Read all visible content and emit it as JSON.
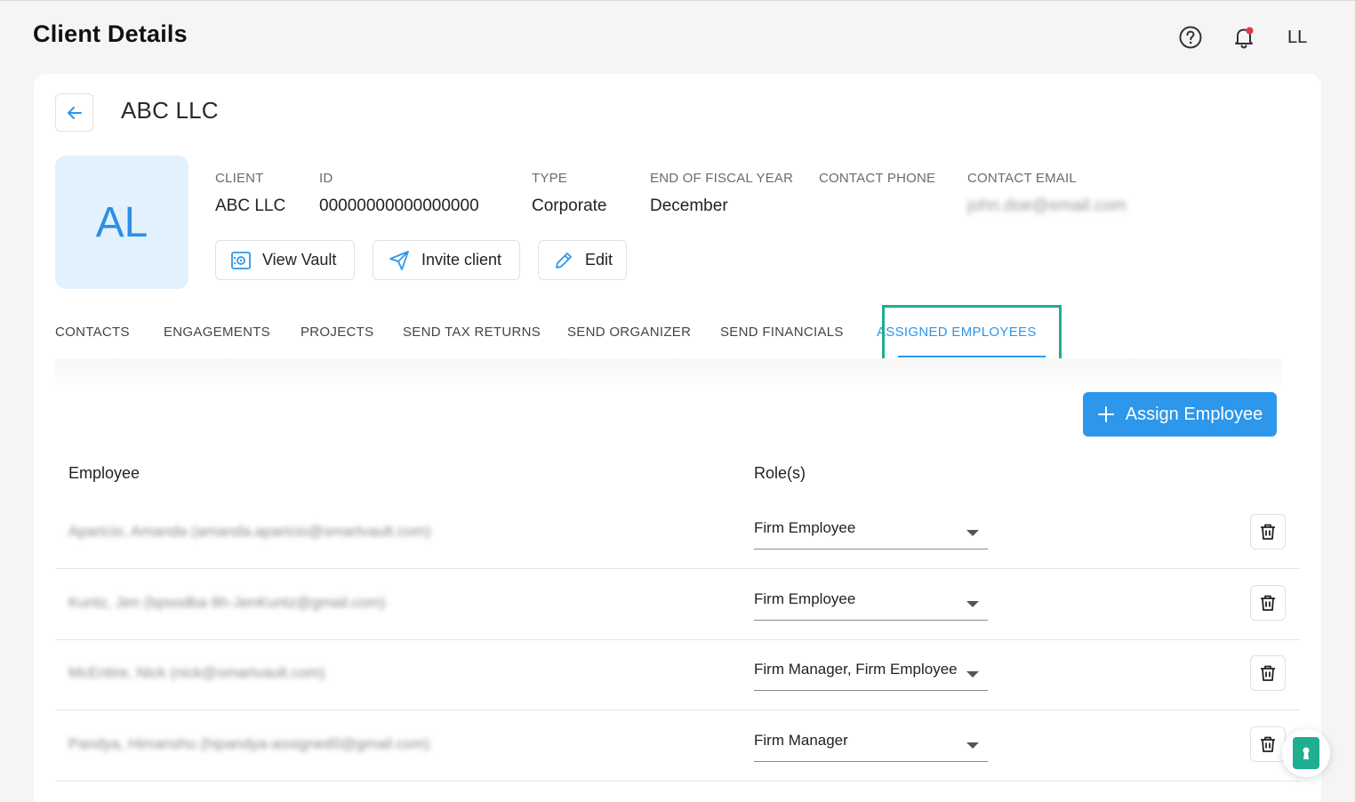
{
  "header": {
    "title": "Client Details",
    "user_initials": "LL"
  },
  "client": {
    "name": "ABC LLC",
    "avatar_initials": "AL",
    "fields": [
      {
        "label": "CLIENT",
        "value": "ABC LLC"
      },
      {
        "label": "ID",
        "value": "00000000000000000"
      },
      {
        "label": "TYPE",
        "value": "Corporate"
      },
      {
        "label": "END OF FISCAL YEAR",
        "value": "December"
      },
      {
        "label": "CONTACT PHONE",
        "value": ""
      },
      {
        "label": "CONTACT EMAIL",
        "value": "john.doe@email.com"
      }
    ]
  },
  "actions": {
    "view_vault": "View Vault",
    "invite_client": "Invite client",
    "edit": "Edit"
  },
  "tabs": [
    {
      "label": "CONTACTS"
    },
    {
      "label": "ENGAGEMENTS"
    },
    {
      "label": "PROJECTS"
    },
    {
      "label": "SEND TAX RETURNS"
    },
    {
      "label": "SEND ORGANIZER"
    },
    {
      "label": "SEND FINANCIALS"
    },
    {
      "label": "ASSIGNED EMPLOYEES"
    }
  ],
  "active_tab": "ASSIGNED EMPLOYEES",
  "assign_button": "Assign Employee",
  "table": {
    "headers": {
      "employee": "Employee",
      "roles": "Role(s)"
    },
    "rows": [
      {
        "employee": "Aparicio, Amanda (amanda.aparicio@smartvault.com)",
        "roles": "Firm Employee"
      },
      {
        "employee": "Kuntz, Jen (bpsodba 8h-JenKuntz@gmail.com)",
        "roles": "Firm Employee"
      },
      {
        "employee": "McEntire, Nick (nick@smartvault.com)",
        "roles": "Firm Manager, Firm Employee"
      },
      {
        "employee": "Pandya, Himanshu (hipandya-assigned0@gmail.com)",
        "roles": "Firm Manager"
      }
    ]
  },
  "colors": {
    "accent": "#2c97eb",
    "highlight": "#1fae8f",
    "avatar_bg": "#e3f1fd",
    "notification_dot": "#e03a4a"
  },
  "icons": {
    "help": "help-circle-icon",
    "notifications": "bell-icon",
    "back": "arrow-left-icon",
    "view_vault": "vault-icon",
    "invite": "send-icon",
    "edit": "pencil-icon",
    "assign": "plus-icon",
    "delete": "trash-icon",
    "floating": "smartvault-icon"
  }
}
